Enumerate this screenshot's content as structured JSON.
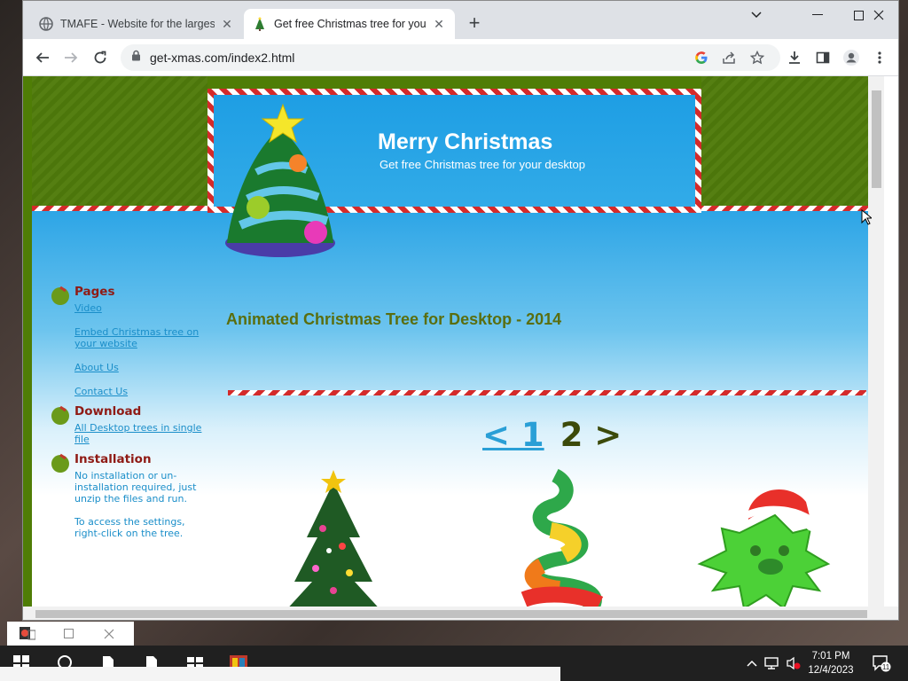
{
  "browser": {
    "tabs": [
      {
        "title": "TMAFE - Website for the largest f",
        "active": false
      },
      {
        "title": "Get free Christmas tree for your d",
        "active": true
      }
    ],
    "url": "get-xmas.com/index2.html"
  },
  "site": {
    "title": "Merry Christmas",
    "subtitle": "Get free Christmas tree for your desktop"
  },
  "sidebar": {
    "pages_title": "Pages",
    "links": [
      "Video",
      "Embed Christmas tree on your website",
      "About Us",
      "Contact Us"
    ],
    "download_title": "Download",
    "download_link": "All Desktop trees in single file",
    "install_title": "Installation",
    "install_text": "No installation or un-installation required, just unzip the files and run.",
    "settings_text": "To access the settings, right-click on the tree."
  },
  "main": {
    "heading": "Animated Christmas Tree for Desktop - 2014",
    "pager_prev": "< 1",
    "pager_next": "2 >"
  },
  "taskbar": {
    "time": "7:01 PM",
    "date": "12/4/2023",
    "notification_count": "11"
  },
  "colors": {
    "accent_red": "#d42a2a",
    "page_green": "#4f7d06",
    "sky_blue": "#2da5e6"
  }
}
